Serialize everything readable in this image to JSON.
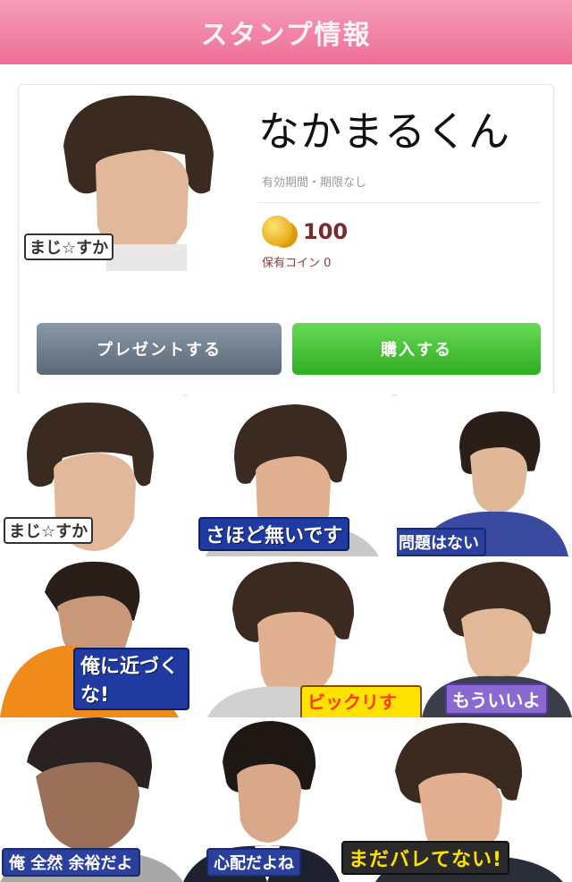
{
  "header": {
    "title": "スタンプ情報"
  },
  "stamp": {
    "title": "なかまるくん",
    "validity": "有効期間・期限なし",
    "price": "100",
    "owned_coins": "保有コイン 0",
    "thumbnail_caption": "まじ☆すか"
  },
  "buttons": {
    "present": "プレゼントする",
    "buy": "購入する"
  },
  "stickers": [
    {
      "caption": "まじ☆すか"
    },
    {
      "caption": "さほど無いです"
    },
    {
      "caption": "問題はない"
    },
    {
      "caption": "俺に近づくな!"
    },
    {
      "caption": "ビックリする!"
    },
    {
      "caption": "もういいよ"
    },
    {
      "caption": "俺 全然 余裕だよ"
    },
    {
      "caption": "心配だよね"
    },
    {
      "caption": "まだバレてない!"
    }
  ],
  "colors": {
    "header": "#ef6e98",
    "present_button": "#6a7888",
    "buy_button": "#3fbb30",
    "coin": "#e7ad16"
  }
}
